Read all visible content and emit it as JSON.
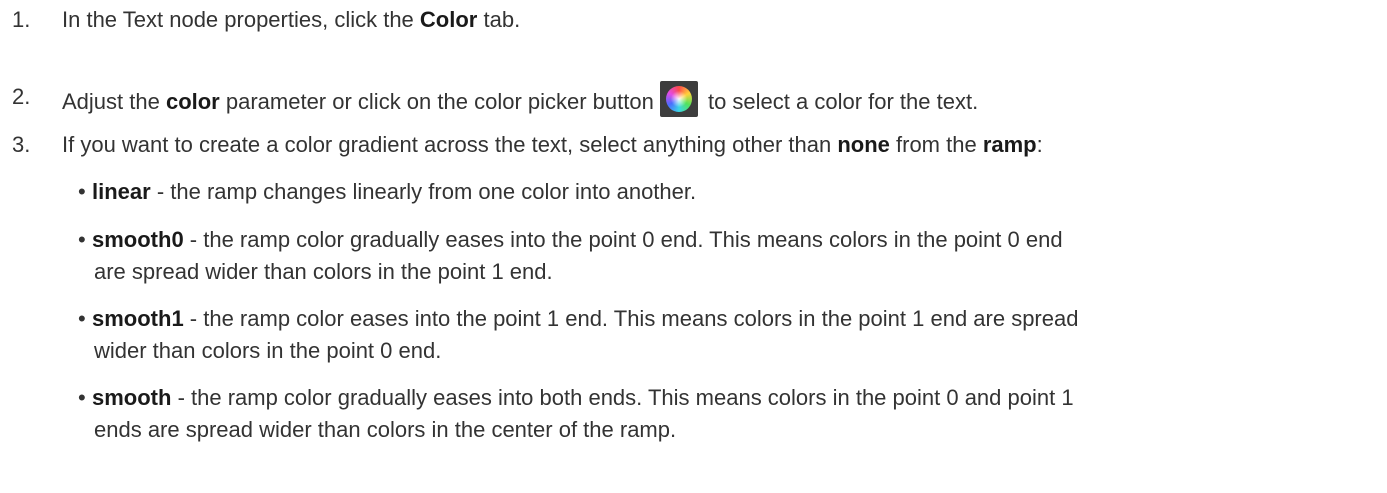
{
  "steps": [
    {
      "num": "1.",
      "pre": "In the Text node properties, click the ",
      "bold": "Color",
      "post": " tab."
    },
    {
      "num": "2.",
      "pre": "Adjust the ",
      "bold": "color",
      "mid": " parameter or click on the color picker button",
      "post": " to select a color for the text."
    },
    {
      "num": "3.",
      "pre": "If you want to create a color gradient across the text, select anything other than ",
      "bold1": "none",
      "mid": " from the ",
      "bold2": "ramp",
      "post": ":"
    }
  ],
  "ramp_options": [
    {
      "name": "linear",
      "line1": " - the ramp changes linearly from one color into another.",
      "line2": ""
    },
    {
      "name": "smooth0",
      "line1": " - the ramp color gradually eases into the point 0 end. This means colors in the point 0 end",
      "line2": "are spread wider than colors in the point 1 end."
    },
    {
      "name": "smooth1",
      "line1": " - the ramp color eases into the point 1 end. This means colors in the point 1 end are spread",
      "line2": "wider than colors in the point 0 end."
    },
    {
      "name": "smooth",
      "line1": " - the ramp color gradually eases into both ends. This means colors in the point 0 and point 1",
      "line2": "ends are spread wider than colors in the center of the ramp."
    }
  ],
  "bullet": "•",
  "icons": {
    "color_picker": "color-wheel-icon"
  }
}
